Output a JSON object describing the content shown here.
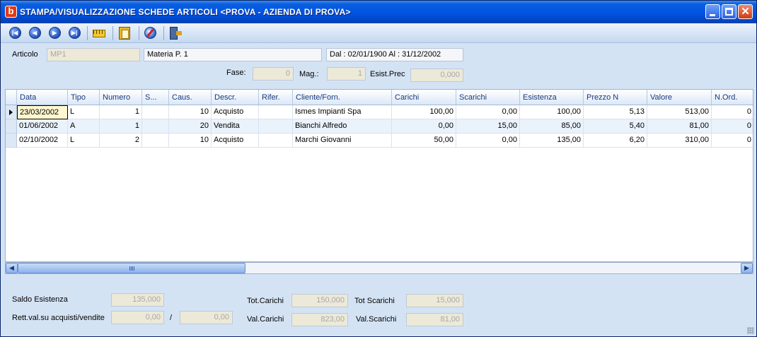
{
  "window": {
    "title": "STAMPA/VISUALIZZAZIONE SCHEDE ARTICOLI <PROVA - AZIENDA DI PROVA>",
    "app_icon_letter": "b",
    "close_glyph": "✕"
  },
  "toolbar": {
    "icons": [
      "first-record-icon",
      "previous-record-icon",
      "next-record-icon",
      "last-record-icon",
      "ruler-icon",
      "document-icon",
      "globe-icon",
      "exit-icon"
    ]
  },
  "header": {
    "articolo_label": "Articolo",
    "articolo_code": "MP1",
    "articolo_desc": "Materia P. 1",
    "period": "Dal : 02/01/1900  Al : 31/12/2002",
    "fase_label": "Fase:",
    "fase_value": "0",
    "mag_label": "Mag.:",
    "mag_value": "1",
    "esist_prec_label": "Esist.Prec",
    "esist_prec_value": "0,000"
  },
  "grid": {
    "columns": [
      "Data",
      "Tipo",
      "Numero",
      "S...",
      "Caus.",
      "Descr.",
      "Rifer.",
      "Cliente/Forn.",
      "Carichi",
      "Scarichi",
      "Esistenza",
      "Prezzo N",
      "Valore",
      "N.Ord."
    ],
    "rows": [
      [
        "23/03/2002",
        "L",
        "1",
        "",
        "10",
        "Acquisto",
        "",
        "Ismes Impianti Spa",
        "100,00",
        "0,00",
        "100,00",
        "5,13",
        "513,00",
        "0"
      ],
      [
        "01/06/2002",
        "A",
        "1",
        "",
        "20",
        "Vendita",
        "",
        "Bianchi Alfredo",
        "0,00",
        "15,00",
        "85,00",
        "5,40",
        "81,00",
        "0"
      ],
      [
        "02/10/2002",
        "L",
        "2",
        "",
        "10",
        "Acquisto",
        "",
        "Marchi Giovanni",
        "50,00",
        "0,00",
        "135,00",
        "6,20",
        "310,00",
        "0"
      ]
    ]
  },
  "scrollbar": {
    "left_glyph": "◀",
    "right_glyph": "▶"
  },
  "footer": {
    "saldo_label": "Saldo Esistenza",
    "saldo_value": "135,000",
    "rett_label": "Rett.val.su acquisti/vendite",
    "rett_value1": "0,00",
    "slash": "/",
    "rett_value2": "0,00",
    "tot_carichi_label": "Tot.Carichi",
    "tot_carichi_value": "150,000",
    "tot_scarichi_label": "Tot Scarichi",
    "tot_scarichi_value": "15,000",
    "val_carichi_label": "Val.Carichi",
    "val_carichi_value": "823,00",
    "val_scarichi_label": "Val.Scarichi",
    "val_scarichi_value": "81,00"
  }
}
